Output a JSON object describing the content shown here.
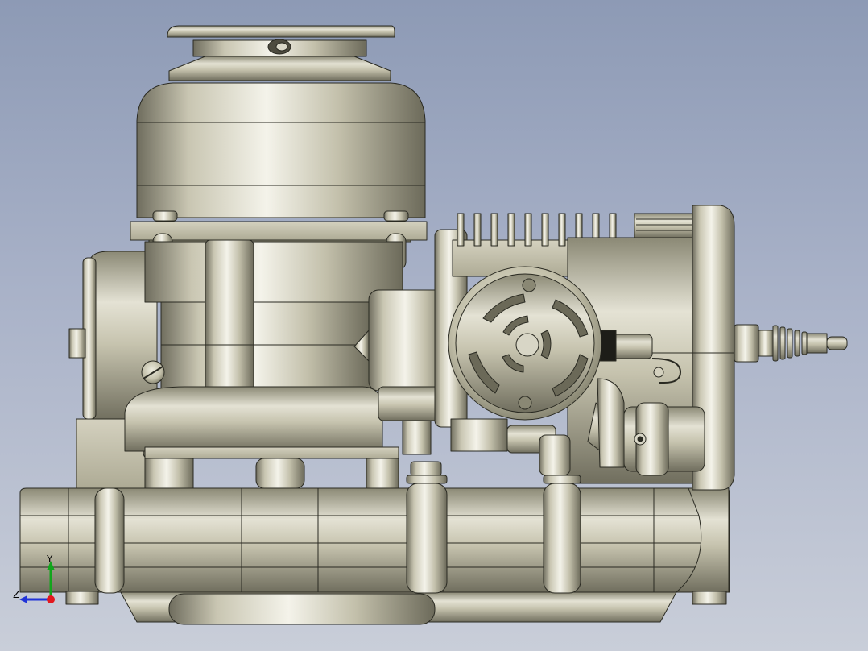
{
  "viewport": {
    "background_top": "#8d9ab5",
    "background_bottom": "#c9ced9",
    "model_color": "#bdbaa3",
    "edge_color": "#2a2a22"
  },
  "triad": {
    "axis_y_label": "Y",
    "axis_z_label": "Z",
    "y_color": "#12a51c",
    "z_color": "#2033d8",
    "x_color": "#e3181e"
  }
}
